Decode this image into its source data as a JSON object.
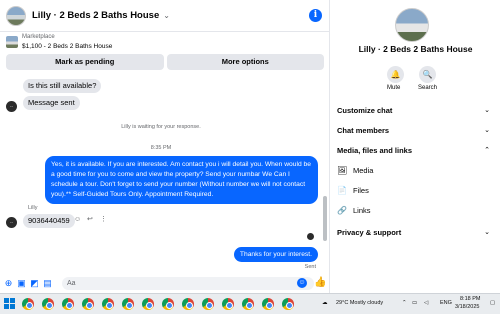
{
  "header": {
    "title": "Lilly · 2 Beds 2 Baths House",
    "info_icon": "info-icon"
  },
  "marketplace": {
    "label": "Marketplace",
    "listing": "$1,100 - 2 Beds 2 Baths House"
  },
  "actions": {
    "pending": "Mark as pending",
    "more": "More options"
  },
  "messages": {
    "q1": "Is this still available?",
    "q2": "Message sent",
    "waiting": "Lilly is waiting for your response.",
    "time": "8:35 PM",
    "reply": "Yes, it is available. If you are interested.  Am contact you i will detail you.  When would be a good time for you to come and view the property? Send your numbar We Can I schedule a tour.  Don't forget to send your number (Without number we will not contact you).** Self-Guided Tours Only. Appointment Required.",
    "sender": "Lilly",
    "phone": "9036440459",
    "thanks": "Thanks for your interest.",
    "sent": "Sent"
  },
  "composer": {
    "placeholder": "Aa"
  },
  "side": {
    "name": "Lilly · 2 Beds 2 Baths House",
    "mute": "Mute",
    "search": "Search",
    "customize": "Customize chat",
    "members": "Chat members",
    "media_files": "Media, files and links",
    "media": "Media",
    "files": "Files",
    "links": "Links",
    "privacy": "Privacy & support"
  },
  "taskbar": {
    "weather": "29°C  Mostly cloudy",
    "lang": "ENG",
    "time": "8:18 PM",
    "date": "3/18/2025"
  },
  "colors": {
    "accent": "#0866ff",
    "bubble_in": "#e4e6eb"
  }
}
